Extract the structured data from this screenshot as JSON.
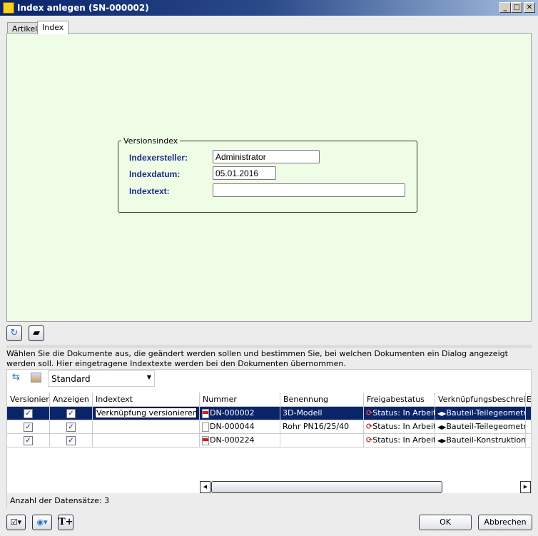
{
  "window": {
    "title": "Index anlegen (SN-000002)",
    "controls": [
      "_",
      "□",
      "✕"
    ]
  },
  "tabs": [
    {
      "label": "Artikel",
      "active": false
    },
    {
      "label": "Index",
      "active": true
    }
  ],
  "versionsindex": {
    "legend": "Versionsindex",
    "fields": [
      {
        "label": "Indexersteller:",
        "value": "Administrator"
      },
      {
        "label": "Indexdatum:",
        "value": "05.01.2016"
      },
      {
        "label": "Indextext:",
        "value": ""
      }
    ]
  },
  "toolbar_icons": [
    "refresh-icon",
    "eraser-icon"
  ],
  "info_text": "Wählen Sie die Dokumente aus, die geändert werden sollen und bestimmen Sie, bei welchen Dokumenten ein Dialog angezeigt werden soll. Hier eingetragene Indextexte werden bei den Dokumenten übernommen.",
  "grid": {
    "view_select": "Standard",
    "columns": [
      "Versioniere",
      "Anzeigen",
      "Indextext",
      "Nummer",
      "Benennung",
      "Freigabestatus",
      "Verknüpfungsbeschreibu",
      "E"
    ],
    "rows": [
      {
        "versionieren": true,
        "anzeigen": true,
        "indextext": "Verknüpfung versionieren",
        "nummer": "DN-000002",
        "doc_icon": "red",
        "benennung": "3D-Modell",
        "status": "Status: In Arbeit",
        "link": "Bauteil-Teilegeometrie",
        "selected": true
      },
      {
        "versionieren": true,
        "anzeigen": true,
        "indextext": "",
        "nummer": "DN-000044",
        "doc_icon": "blank",
        "benennung": "Rohr PN16/25/40",
        "status": "Status: In Arbeit",
        "link": "Bauteil-Teilegeometrie",
        "selected": false
      },
      {
        "versionieren": true,
        "anzeigen": true,
        "indextext": "",
        "nummer": "DN-000224",
        "doc_icon": "red",
        "benennung": "",
        "status": "Status: In Arbeit",
        "link": "Bauteil-Konstruktion",
        "selected": false
      }
    ],
    "record_count": "Anzahl der Datensätze: 3"
  },
  "buttons": {
    "ok": "OK",
    "cancel": "Abbrechen"
  }
}
